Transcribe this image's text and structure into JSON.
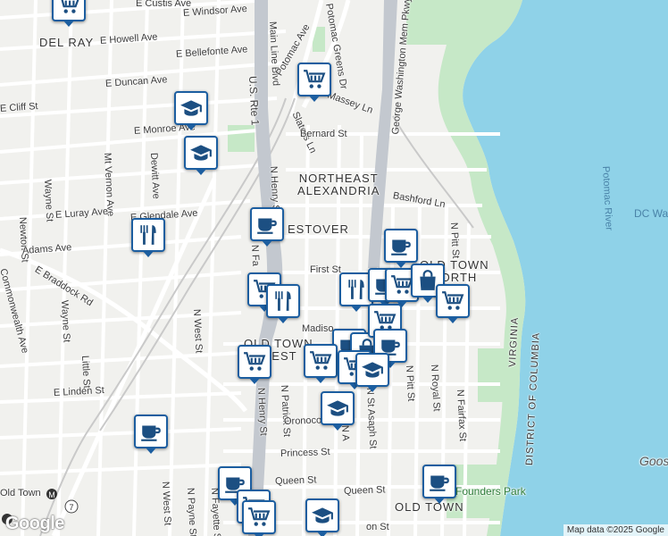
{
  "map": {
    "attribution": "Map data ©2025 Google",
    "logo": "Google",
    "colors": {
      "water": "#8fd2e8",
      "park": "#c6e8c7",
      "land": "#f1f1ee",
      "road": "#ffffff",
      "highway": "#c3c8cf",
      "pin_border": "#1c5ea0"
    }
  },
  "labels": {
    "e_custis": "E Custis Ave",
    "e_windsor": "E Windsor Ave",
    "del_ray": "DEL RAY",
    "e_howell": "E Howell Ave",
    "e_bellefonte": "E Bellefonte Ave",
    "e_duncan": "E Duncan Ave",
    "e_cliff": "E Cliff St",
    "e_monroe": "E Monroe Ave",
    "mt_vernon": "Mt Vernon Ave",
    "dewitt": "Dewitt Ave",
    "wayne_top": "Wayne St",
    "newton": "Newton St",
    "e_luray": "E Luray Ave",
    "e_lee": "E Glendale Ave",
    "adams": "Adams Ave",
    "e_braddock": "E Braddock Rd",
    "commonwealth": "Commonwealth Ave",
    "wayne_low": "Wayne St",
    "little": "Little St",
    "e_linden": "E Linden St",
    "n_west_mid": "N West St",
    "n_west_low": "N West St",
    "n_payne": "N Payne St",
    "n_fayette_low": "N Fayette St",
    "us_rte1": "U.S. Rte 1",
    "main_line": "Main Line Blvd",
    "potomac_greens": "Potomac Greens Dr",
    "potomac_ave": "Potomac Ave",
    "massey": "Massey Ln",
    "slaters": "Slaters Ln",
    "bernard": "Bernard St",
    "gw_mem": "George Washington Mem Pkwy",
    "northeast_alexandria": "NORTHEAST\nALEXANDRIA",
    "bashford": "Bashford Ln",
    "potomac_river": "Potomac River",
    "dc_wa": "DC Wa",
    "n_henry_top": "N Henry St",
    "n_fayette_top": "N Fa",
    "estover": "ESTOVER",
    "first_st": "First St",
    "old_town_north": "OLD TOWN\nNORTH",
    "n_pitt_top": "N Pitt St",
    "madison": "Madiso",
    "old_town_west": "OLD TOWN\nWEST",
    "n_henry_low": "N Henry St",
    "n_patrick": "N Patrick St",
    "n_pitt_low": "N Pitt St",
    "n_royal": "N Royal St",
    "n_fairfax": "N Fairfax St",
    "n_st_asaph": "N St Asaph St",
    "n_alfred": "N A",
    "oronoco": "Oronoco St",
    "princess": "Princess St",
    "queen_w": "Queen St",
    "queen_e": "Queen St",
    "old_town": "OLD TOWN",
    "founders_park": "Founders Park",
    "virginia": "VIRGINIA",
    "dc": "DISTRICT OF COLUMBIA",
    "goos": "Goos",
    "old_town_station": "Old Town",
    "route7": "7",
    "cameron": "on St"
  },
  "markers": [
    {
      "type": "shopping-cart",
      "name": "grocery-marker"
    },
    {
      "type": "shopping-cart",
      "name": "grocery-marker"
    },
    {
      "type": "graduation-cap",
      "name": "school-marker"
    },
    {
      "type": "graduation-cap",
      "name": "school-marker"
    },
    {
      "type": "fork-knife",
      "name": "restaurant-marker"
    },
    {
      "type": "coffee-cup",
      "name": "cafe-marker"
    },
    {
      "type": "coffee-cup",
      "name": "cafe-marker"
    },
    {
      "type": "shopping-cart",
      "name": "grocery-marker"
    },
    {
      "type": "fork-knife",
      "name": "restaurant-marker"
    },
    {
      "type": "fork-knife",
      "name": "restaurant-marker"
    },
    {
      "type": "coffee-cup",
      "name": "cafe-marker"
    },
    {
      "type": "shopping-cart",
      "name": "grocery-marker"
    },
    {
      "type": "shopping-bag",
      "name": "store-marker"
    },
    {
      "type": "shopping-cart",
      "name": "grocery-marker"
    },
    {
      "type": "coffee-cup",
      "name": "cafe-marker"
    },
    {
      "type": "shopping-bag",
      "name": "store-marker"
    },
    {
      "type": "shopping-cart",
      "name": "grocery-marker"
    },
    {
      "type": "coffee-cup",
      "name": "cafe-marker"
    },
    {
      "type": "shopping-cart",
      "name": "grocery-marker"
    },
    {
      "type": "shopping-cart",
      "name": "grocery-marker"
    },
    {
      "type": "graduation-cap",
      "name": "school-marker"
    },
    {
      "type": "graduation-cap",
      "name": "school-marker"
    },
    {
      "type": "coffee-cup",
      "name": "cafe-marker"
    },
    {
      "type": "shopping-cart",
      "name": "grocery-marker"
    },
    {
      "type": "coffee-cup",
      "name": "cafe-marker"
    },
    {
      "type": "shopping-cart",
      "name": "grocery-marker"
    },
    {
      "type": "shopping-cart",
      "name": "grocery-marker"
    },
    {
      "type": "graduation-cap",
      "name": "school-marker"
    },
    {
      "type": "coffee-cup",
      "name": "cafe-marker"
    }
  ]
}
